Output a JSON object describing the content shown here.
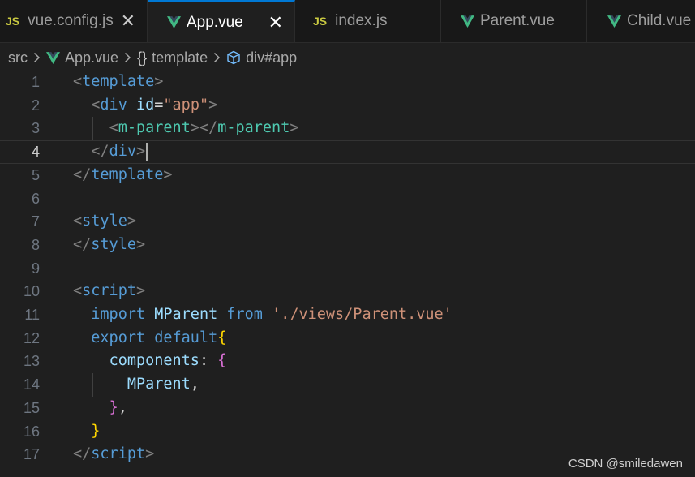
{
  "tabs": [
    {
      "label": "vue.config.js",
      "icon": "js-icon",
      "icon_text": "JS",
      "active": false,
      "close": "✕"
    },
    {
      "label": "App.vue",
      "icon": "vue-icon",
      "active": true,
      "close": "✕"
    },
    {
      "label": "index.js",
      "icon": "js-icon",
      "icon_text": "JS",
      "active": false
    },
    {
      "label": "Parent.vue",
      "icon": "vue-icon",
      "active": false
    },
    {
      "label": "Child.vue",
      "icon": "vue-icon",
      "active": false
    }
  ],
  "breadcrumb": {
    "folder": "src",
    "file": "App.vue",
    "template_icon": "{}",
    "template": "template",
    "element": "div#app"
  },
  "line_numbers": [
    "1",
    "2",
    "3",
    "4",
    "5",
    "6",
    "7",
    "8",
    "9",
    "10",
    "11",
    "12",
    "13",
    "14",
    "15",
    "16",
    "17"
  ],
  "code_lines": [
    [
      {
        "t": "<",
        "c": "c-punc"
      },
      {
        "t": "template",
        "c": "c-tag"
      },
      {
        "t": ">",
        "c": "c-punc"
      }
    ],
    [
      {
        "t": "  "
      },
      {
        "t": "<",
        "c": "c-punc"
      },
      {
        "t": "div",
        "c": "c-tag"
      },
      {
        "t": " "
      },
      {
        "t": "id",
        "c": "c-attr"
      },
      {
        "t": "=",
        "c": "c-txt"
      },
      {
        "t": "\"app\"",
        "c": "c-str"
      },
      {
        "t": ">",
        "c": "c-punc"
      }
    ],
    [
      {
        "t": "    "
      },
      {
        "t": "<",
        "c": "c-punc"
      },
      {
        "t": "m-parent",
        "c": "c-comp"
      },
      {
        "t": "></",
        "c": "c-punc"
      },
      {
        "t": "m-parent",
        "c": "c-comp"
      },
      {
        "t": ">",
        "c": "c-punc"
      }
    ],
    [
      {
        "t": "  "
      },
      {
        "t": "</",
        "c": "c-punc"
      },
      {
        "t": "div",
        "c": "c-tag"
      },
      {
        "t": ">",
        "c": "c-punc"
      }
    ],
    [
      {
        "t": "</",
        "c": "c-punc"
      },
      {
        "t": "template",
        "c": "c-tag"
      },
      {
        "t": ">",
        "c": "c-punc"
      }
    ],
    [],
    [
      {
        "t": "<",
        "c": "c-punc"
      },
      {
        "t": "style",
        "c": "c-tag"
      },
      {
        "t": ">",
        "c": "c-punc"
      }
    ],
    [
      {
        "t": "</",
        "c": "c-punc"
      },
      {
        "t": "style",
        "c": "c-tag"
      },
      {
        "t": ">",
        "c": "c-punc"
      }
    ],
    [],
    [
      {
        "t": "<",
        "c": "c-punc"
      },
      {
        "t": "script",
        "c": "c-tag"
      },
      {
        "t": ">",
        "c": "c-punc"
      }
    ],
    [
      {
        "t": "  "
      },
      {
        "t": "import",
        "c": "c-kwb"
      },
      {
        "t": " "
      },
      {
        "t": "MParent",
        "c": "c-var"
      },
      {
        "t": " "
      },
      {
        "t": "from",
        "c": "c-kwb"
      },
      {
        "t": " "
      },
      {
        "t": "'./views/Parent.vue'",
        "c": "c-str"
      }
    ],
    [
      {
        "t": "  "
      },
      {
        "t": "export",
        "c": "c-kwb"
      },
      {
        "t": " "
      },
      {
        "t": "default",
        "c": "c-kwb"
      },
      {
        "t": "{",
        "c": "c-b1"
      }
    ],
    [
      {
        "t": "    "
      },
      {
        "t": "components",
        "c": "c-var"
      },
      {
        "t": ": ",
        "c": "c-txt"
      },
      {
        "t": "{",
        "c": "c-b2"
      }
    ],
    [
      {
        "t": "      "
      },
      {
        "t": "MParent",
        "c": "c-var"
      },
      {
        "t": ",",
        "c": "c-txt"
      }
    ],
    [
      {
        "t": "    "
      },
      {
        "t": "}",
        "c": "c-b2"
      },
      {
        "t": ",",
        "c": "c-txt"
      }
    ],
    [
      {
        "t": "  "
      },
      {
        "t": "}",
        "c": "c-b1"
      }
    ],
    [
      {
        "t": "</",
        "c": "c-punc"
      },
      {
        "t": "script",
        "c": "c-tag"
      },
      {
        "t": ">",
        "c": "c-punc"
      }
    ]
  ],
  "watermark": "CSDN @smiledawen",
  "colors": {
    "accent": "#0078d4",
    "js": "#cbcb41",
    "vue": "#41b883"
  }
}
